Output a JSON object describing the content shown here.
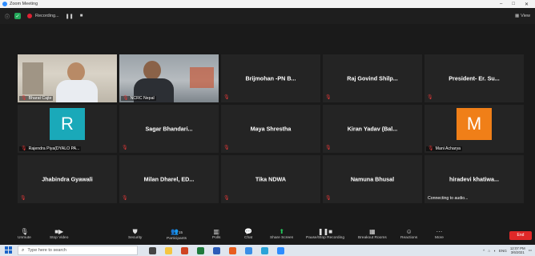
{
  "window": {
    "title": "Zoom Meeting"
  },
  "topbar": {
    "recording_label": "Recording...",
    "view_label": "View"
  },
  "tiles": [
    {
      "name": "",
      "label": "Bharat Cajte",
      "type": "video1"
    },
    {
      "name": "",
      "label": "NCRC Nepal",
      "type": "video2"
    },
    {
      "name": "Brijmohan -PN B...",
      "label": "",
      "type": "name"
    },
    {
      "name": "Raj Govind Shilp...",
      "label": "",
      "type": "name"
    },
    {
      "name": "President- Er. Su...",
      "label": "",
      "type": "name"
    },
    {
      "name": "",
      "label": "Rajendra Piya(DYALO PA...",
      "type": "avatar",
      "avatar_letter": "R",
      "avatar_color": "#1aa9b9"
    },
    {
      "name": "Sagar Bhandari...",
      "label": "",
      "type": "name"
    },
    {
      "name": "Maya Shrestha",
      "label": "",
      "type": "name"
    },
    {
      "name": "Kiran Yadav (Bal...",
      "label": "",
      "type": "name"
    },
    {
      "name": "",
      "label": "Mani Acharya",
      "type": "avatar",
      "avatar_letter": "M",
      "avatar_color": "#f07f18"
    },
    {
      "name": "Jhabindra Gyawali",
      "label": "",
      "type": "name"
    },
    {
      "name": "Milan Dharel, ED...",
      "label": "",
      "type": "name"
    },
    {
      "name": "Tika NDWA",
      "label": "",
      "type": "name"
    },
    {
      "name": "Namuna Bhusal",
      "label": "",
      "type": "name"
    },
    {
      "name": "hiradevi khatiwa...",
      "label": "",
      "type": "name",
      "status": "Connecting to audio..."
    }
  ],
  "toolbar": {
    "unmute": "Unmute",
    "stop_video": "Stop Video",
    "security": "Security",
    "participants": "Participants",
    "participants_count": "15",
    "polls": "Polls",
    "chat": "Chat",
    "share_screen": "Share Screen",
    "pause_recording": "Pause/Stop Recording",
    "breakout_rooms": "Breakout Rooms",
    "reactions": "Reactions",
    "more": "More",
    "end": "End"
  },
  "taskbar": {
    "search_placeholder": "Type here to search",
    "language": "ENG",
    "time": "12:07 PM",
    "date": "3/6/2021"
  },
  "colors": {
    "accent_green": "#9ad63a",
    "end_red": "#e02828",
    "share_green": "#23c35a"
  }
}
